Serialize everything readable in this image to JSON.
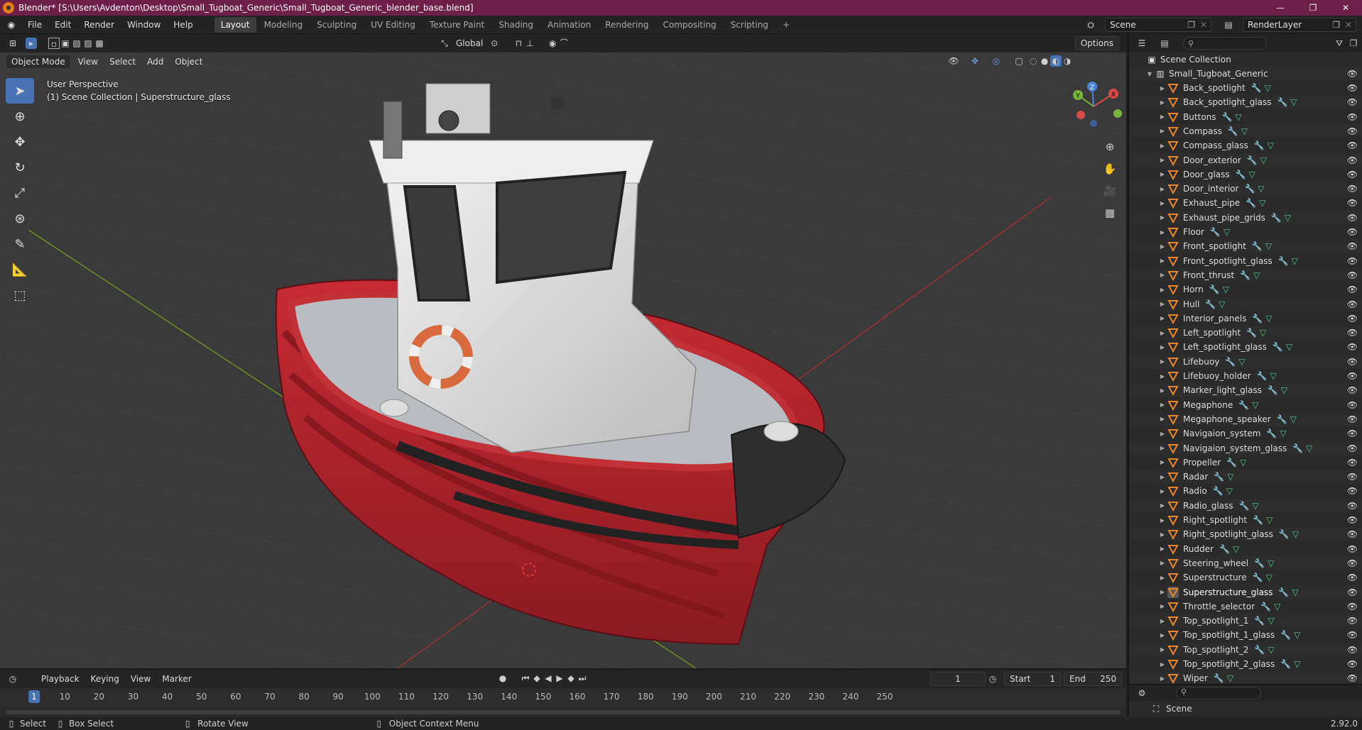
{
  "window": {
    "title": "Blender* [S:\\Users\\Avdenton\\Desktop\\Small_Tugboat_Generic\\Small_Tugboat_Generic_blender_base.blend]",
    "controls": [
      "—",
      "❐",
      "✕"
    ]
  },
  "menubar": {
    "menus": [
      "File",
      "Edit",
      "Render",
      "Window",
      "Help"
    ],
    "workspaces": [
      "Layout",
      "Modeling",
      "Sculpting",
      "UV Editing",
      "Texture Paint",
      "Shading",
      "Animation",
      "Rendering",
      "Compositing",
      "Scripting"
    ],
    "active_workspace": "Layout",
    "add_tab": "+",
    "scene": "Scene",
    "view_layer": "RenderLayer"
  },
  "viewport": {
    "transform_orientation": "Global",
    "options_label": "Options",
    "mode": "Object Mode",
    "menus": [
      "View",
      "Select",
      "Add",
      "Object"
    ],
    "info_line1": "User Perspective",
    "info_line2": "(1) Scene Collection | Superstructure_glass",
    "gizmo": {
      "x": "X",
      "y": "Y",
      "z": "Z"
    }
  },
  "timeline": {
    "menus": [
      "Playback",
      "Keying",
      "View",
      "Marker"
    ],
    "current_frame": "1",
    "start_label": "Start",
    "start": "1",
    "end_label": "End",
    "end": "250",
    "ticks": [
      "1",
      "10",
      "20",
      "30",
      "40",
      "50",
      "60",
      "70",
      "80",
      "90",
      "100",
      "110",
      "120",
      "130",
      "140",
      "150",
      "160",
      "170",
      "180",
      "190",
      "200",
      "210",
      "220",
      "230",
      "240",
      "250"
    ]
  },
  "statusbar": {
    "items": [
      "Select",
      "Box Select",
      "Rotate View",
      "Object Context Menu"
    ],
    "version": "2.92.0"
  },
  "outliner": {
    "root": "Scene Collection",
    "collection": "Small_Tugboat_Generic",
    "selected": "Superstructure_glass",
    "objects": [
      "Back_spotlight",
      "Back_spotlight_glass",
      "Buttons",
      "Compass",
      "Compass_glass",
      "Door_exterior",
      "Door_glass",
      "Door_interior",
      "Exhaust_pipe",
      "Exhaust_pipe_grids",
      "Floor",
      "Front_spotlight",
      "Front_spotlight_glass",
      "Front_thrust",
      "Horn",
      "Hull",
      "Interior_panels",
      "Left_spotlight",
      "Left_spotlight_glass",
      "Lifebuoy",
      "Lifebuoy_holder",
      "Marker_light_glass",
      "Megaphone",
      "Megaphone_speaker",
      "Navigaion_system",
      "Navigaion_system_glass",
      "Propeller",
      "Radar",
      "Radio",
      "Radio_glass",
      "Right_spotlight",
      "Right_spotlight_glass",
      "Rudder",
      "Steering_wheel",
      "Superstructure",
      "Superstructure_glass",
      "Throttle_selector",
      "Top_spotlight_1",
      "Top_spotlight_1_glass",
      "Top_spotlight_2",
      "Top_spotlight_2_glass",
      "Wiper"
    ]
  },
  "properties": {
    "item": "Scene"
  },
  "colors": {
    "title_bar": "#6e1f47",
    "accent": "#4772b3",
    "mesh_icon": "#e8882e",
    "modifier_icon": "#6f9be2",
    "data_icon": "#52c786",
    "hull_red": "#b3202a"
  }
}
